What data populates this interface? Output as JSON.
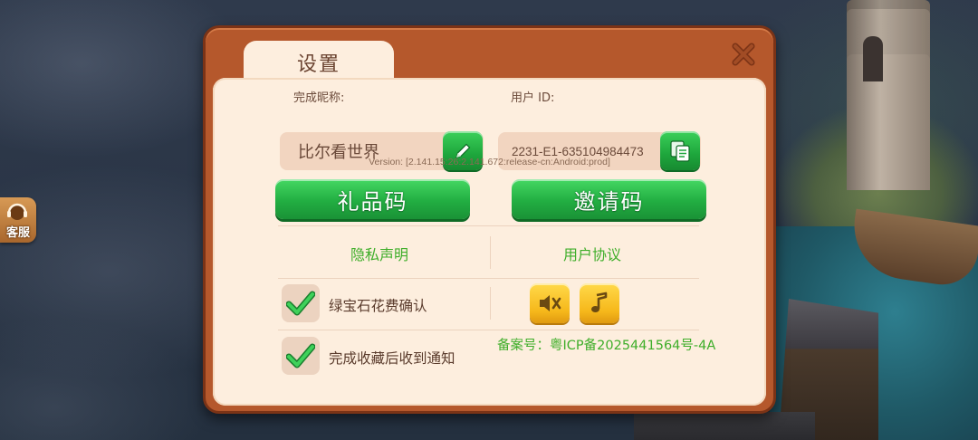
{
  "dialog": {
    "title": "设置",
    "close_icon": "close-icon"
  },
  "profile": {
    "nickname_label": "完成昵称:",
    "nickname_value": "比尔看世界",
    "user_id_label": "用户 ID:",
    "user_id_value": "2231-E1-635104984473",
    "version": "Version: [2.141.15:26:2.141.672:release-cn:Android:prod]"
  },
  "buttons": {
    "gift_code": "礼品码",
    "invite_code": "邀请码"
  },
  "links": {
    "privacy": "隐私声明",
    "user_agreement": "用户协议"
  },
  "options": [
    {
      "label": "绿宝石花费确认",
      "checked": true
    },
    {
      "label": "完成收藏后收到通知",
      "checked": true
    }
  ],
  "sound": {
    "sfx_icon": "speaker-muted-icon",
    "music_icon": "music-note-icon"
  },
  "icp": "备案号：粤ICP备2025441564号-4A",
  "side": {
    "service_label": "客服"
  },
  "colors": {
    "frame": "#b5582c",
    "panel": "#fdeede",
    "green": "#22ae42",
    "link_green": "#3fae2a",
    "yellow": "#f6b81b"
  }
}
